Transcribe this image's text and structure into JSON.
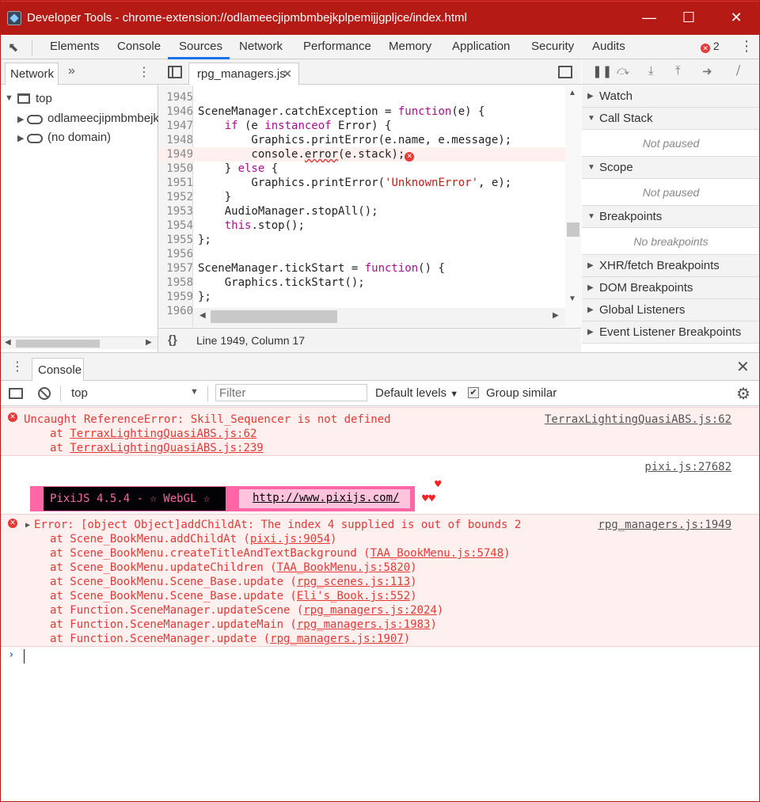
{
  "window": {
    "title": "Developer Tools - chrome-extension://odlameecjipmbmbejkplpemijjgpljce/index.html",
    "minimize": "—",
    "maximize": "☐",
    "close": "✕",
    "accent": "#b51a14"
  },
  "tabs": {
    "items": [
      "Elements",
      "Console",
      "Sources",
      "Network",
      "Performance",
      "Memory",
      "Application",
      "Security",
      "Audits"
    ],
    "active": "Sources",
    "error_count": "2"
  },
  "navigator": {
    "tab": "Network",
    "more": "»",
    "tree": {
      "top": "top",
      "origin": "odlameecjipmbmbejkplpemijjgpljce",
      "no_domain": "(no domain)"
    }
  },
  "editor": {
    "file_tab": "rpg_managers.js",
    "status": "Line 1949, Column 17",
    "format_icon": "{}",
    "line_numbers": [
      "1945",
      "1946",
      "1947",
      "1948",
      "1949",
      "1950",
      "1951",
      "1952",
      "1953",
      "1954",
      "1955",
      "1956",
      "1957",
      "1958",
      "1959",
      "1960"
    ],
    "code": {
      "l1945": "",
      "l1946a": "SceneManager.catchException = ",
      "l1946b": "function",
      "l1946c": "(e) {",
      "l1947a": "    ",
      "l1947b": "if",
      "l1947c": " (e ",
      "l1947d": "instanceof",
      "l1947e": " Error) {",
      "l1948": "        Graphics.printError(e.name, e.message);",
      "l1949a": "        console.",
      "l1949b": "error",
      "l1949c": "(e.stack);",
      "l1950a": "    } ",
      "l1950b": "else",
      "l1950c": " {",
      "l1951a": "        Graphics.printError(",
      "l1951b": "'UnknownError'",
      "l1951c": ", e);",
      "l1952": "    }",
      "l1953": "    AudioManager.stopAll();",
      "l1954a": "    ",
      "l1954b": "this",
      "l1954c": ".stop();",
      "l1955": "};",
      "l1956": "",
      "l1957a": "SceneManager.tickStart = ",
      "l1957b": "function",
      "l1957c": "() {",
      "l1958": "    Graphics.tickStart();",
      "l1959": "};",
      "l1960": ""
    }
  },
  "debugger": {
    "sections": {
      "watch": "Watch",
      "call_stack": "Call Stack",
      "call_stack_empty": "Not paused",
      "scope": "Scope",
      "scope_empty": "Not paused",
      "breakpoints": "Breakpoints",
      "breakpoints_empty": "No breakpoints",
      "xhr": "XHR/fetch Breakpoints",
      "dom": "DOM Breakpoints",
      "global": "Global Listeners",
      "event": "Event Listener Breakpoints"
    }
  },
  "drawer": {
    "tab": "Console",
    "context": "top",
    "filter_placeholder": "Filter",
    "levels": "Default levels",
    "group_similar": "Group similar"
  },
  "console": {
    "msg1": {
      "text": "Uncaught ReferenceError: Skill_Sequencer is not defined",
      "source": "TerraxLightingQuasiABS.js:62",
      "stack": [
        {
          "prefix": "at ",
          "link": "TerraxLightingQuasiABS.js:62"
        },
        {
          "prefix": "at ",
          "link": "TerraxLightingQuasiABS.js:239"
        }
      ]
    },
    "pixi": {
      "source": "pixi.js:27682",
      "banner": "PixiJS 4.5.4 - ☆ WebGL ☆",
      "url": "http://www.pixijs.com/",
      "hearts_top": "♥",
      "hearts_bottom": "♥♥"
    },
    "msg2": {
      "text": "Error: [object Object]addChildAt: The index 4 supplied is out of bounds 2",
      "source": "rpg_managers.js:1949",
      "stack": [
        {
          "prefix": "at Scene_BookMenu.addChildAt (",
          "link": "pixi.js:9054",
          "suffix": ")"
        },
        {
          "prefix": "at Scene_BookMenu.createTitleAndTextBackground (",
          "link": "TAA_BookMenu.js:5748",
          "suffix": ")"
        },
        {
          "prefix": "at Scene_BookMenu.updateChildren (",
          "link": "TAA_BookMenu.js:5820",
          "suffix": ")"
        },
        {
          "prefix": "at Scene_BookMenu.Scene_Base.update (",
          "link": "rpg_scenes.js:113",
          "suffix": ")"
        },
        {
          "prefix": "at Scene_BookMenu.Scene_Base.update (",
          "link": "Eli's_Book.js:552",
          "suffix": ")"
        },
        {
          "prefix": "at Function.SceneManager.updateScene (",
          "link": "rpg_managers.js:2024",
          "suffix": ")"
        },
        {
          "prefix": "at Function.SceneManager.updateMain (",
          "link": "rpg_managers.js:1983",
          "suffix": ")"
        },
        {
          "prefix": "at Function.SceneManager.update (",
          "link": "rpg_managers.js:1907",
          "suffix": ")"
        }
      ]
    },
    "prompt": "›"
  }
}
